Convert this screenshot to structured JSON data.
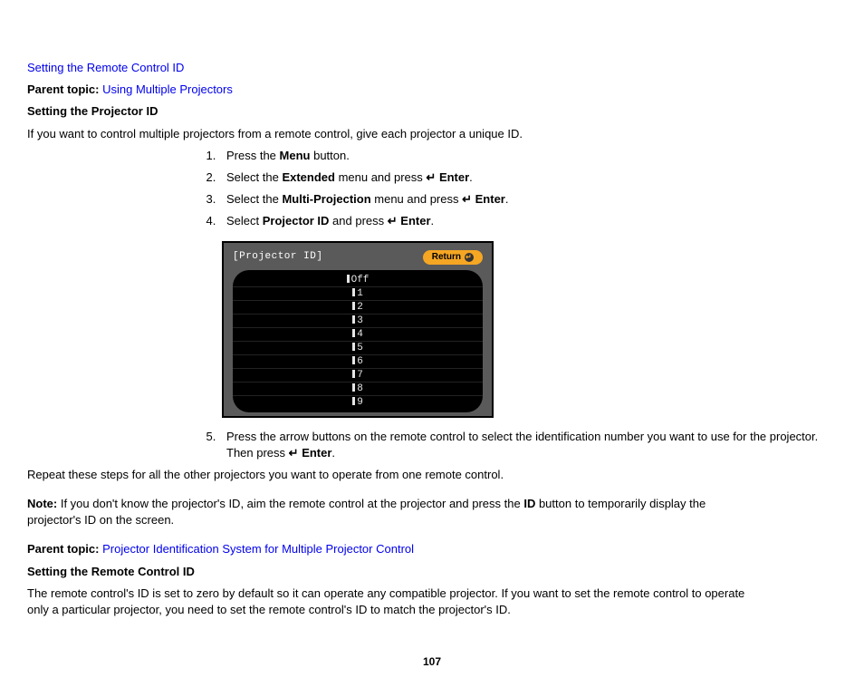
{
  "link1": "Setting the Remote Control ID",
  "parent_label": "Parent topic:",
  "parent_link1": "Using Multiple Projectors",
  "h1": "Setting the Projector ID",
  "intro": "If you want to control multiple projectors from a remote control, give each projector a unique ID.",
  "s1a": "Press the ",
  "s1b": "Menu",
  "s1c": " button.",
  "s2a": "Select the ",
  "s2b": "Extended",
  "s2c": " menu and press ",
  "s2d": "Enter",
  "s2e": ".",
  "s3a": "Select the ",
  "s3b": "Multi-Projection",
  "s3c": " menu and press ",
  "s3d": "Enter",
  "s3e": ".",
  "s4a": "Select ",
  "s4b": "Projector ID",
  "s4c": " and press ",
  "s4d": "Enter",
  "s4e": ".",
  "scr_title": "[Projector ID]",
  "scr_return": "Return",
  "scr_items": [
    "Off",
    "1",
    "2",
    "3",
    "4",
    "5",
    "6",
    "7",
    "8",
    "9"
  ],
  "s5a": "Press the arrow buttons on the remote control to select the identification number you want to use for the projector. Then press ",
  "s5b": "Enter",
  "s5c": ".",
  "repeat": "Repeat these steps for all the other projectors you want to operate from one remote control.",
  "note_label": "Note:",
  "note_a": " If you don't know the projector's ID, aim the remote control at the projector and press the ",
  "note_b": "ID",
  "note_c": " button to temporarily display the projector's ID on the screen.",
  "parent_link2": "Projector Identification System for Multiple Projector Control",
  "h2": "Setting the Remote Control ID",
  "rc_body": "The remote control's ID is set to zero by default so it can operate any compatible projector. If you want to set the remote control to operate only a particular projector, you need to set the remote control's ID to match the projector's ID.",
  "page": "107"
}
